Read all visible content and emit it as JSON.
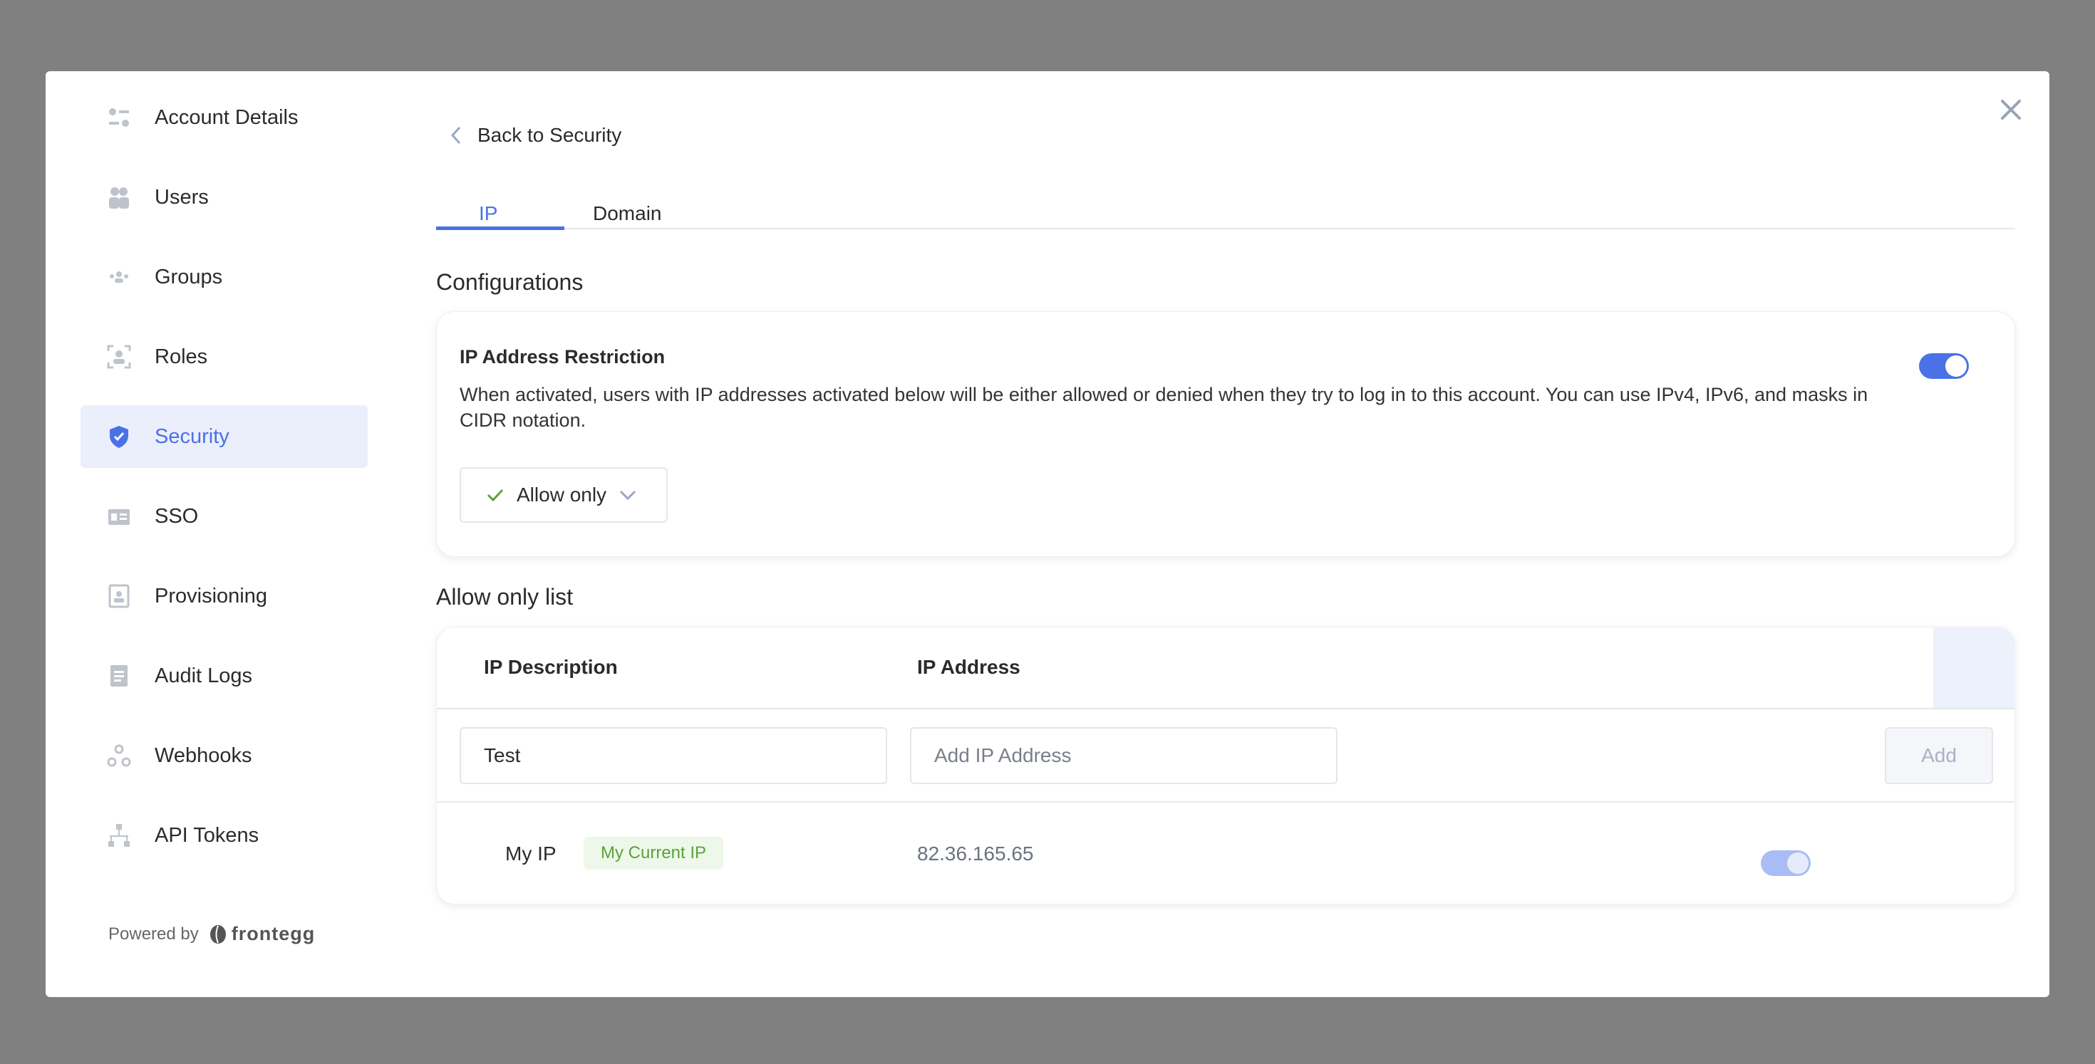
{
  "sidebar": {
    "items": [
      {
        "label": "Account Details",
        "icon": "sliders-icon"
      },
      {
        "label": "Users",
        "icon": "users-icon"
      },
      {
        "label": "Groups",
        "icon": "groups-icon"
      },
      {
        "label": "Roles",
        "icon": "roles-icon"
      },
      {
        "label": "Security",
        "icon": "shield-icon",
        "active": true
      },
      {
        "label": "SSO",
        "icon": "sso-icon"
      },
      {
        "label": "Provisioning",
        "icon": "provisioning-icon"
      },
      {
        "label": "Audit Logs",
        "icon": "document-icon"
      },
      {
        "label": "Webhooks",
        "icon": "webhooks-icon"
      },
      {
        "label": "API Tokens",
        "icon": "api-tokens-icon"
      }
    ],
    "powered_by": "Powered by",
    "brand": "frontegg"
  },
  "header": {
    "back_label": "Back to Security",
    "tabs": [
      {
        "label": "IP",
        "active": true
      },
      {
        "label": "Domain"
      }
    ]
  },
  "config": {
    "title": "Configurations",
    "card_title": "IP Address Restriction",
    "description": "When activated, users with IP addresses activated below will be either allowed or denied when they try to log in to this account. You can use IPv4, IPv6, and masks in CIDR notation.",
    "enabled": true,
    "mode": "Allow only"
  },
  "list": {
    "title": "Allow only list",
    "columns": [
      "IP Description",
      "IP Address"
    ],
    "new_entry": {
      "description_value": "Test",
      "ip_placeholder": "Add IP Address",
      "add_label": "Add"
    },
    "rows": [
      {
        "description": "My IP",
        "badge": "My Current IP",
        "ip": "82.36.165.65",
        "enabled": true
      }
    ]
  },
  "colors": {
    "accent": "#4a72e6",
    "badge_bg": "#eef8ea",
    "badge_text": "#5aa33a"
  }
}
